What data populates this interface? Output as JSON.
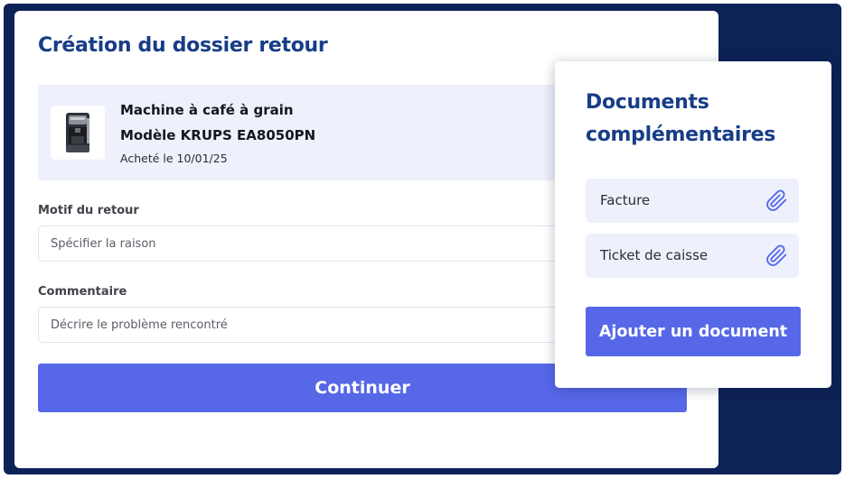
{
  "main": {
    "title": "Création du dossier retour",
    "product": {
      "name": "Machine à café à grain",
      "model": "Modèle KRUPS EA8050PN",
      "purchase_date": "Acheté le 10/01/25",
      "image_icon": "coffee-machine"
    },
    "fields": {
      "reason": {
        "label": "Motif du retour",
        "placeholder": "Spécifier la raison",
        "value": ""
      },
      "comment": {
        "label": "Commentaire",
        "placeholder": "Décrire le problème rencontré",
        "value": ""
      }
    },
    "continue_label": "Continuer"
  },
  "documents": {
    "title_line1": "Documents",
    "title_line2": "complémentaires",
    "items": [
      {
        "label": "Facture",
        "icon": "paperclip-icon"
      },
      {
        "label": "Ticket de caisse",
        "icon": "paperclip-icon"
      }
    ],
    "add_label": "Ajouter un document"
  },
  "colors": {
    "frame_background": "#0d2257",
    "title_blue": "#183d87",
    "accent_button": "#5668e8",
    "light_panel": "#eef0fb",
    "paperclip": "#5668e8"
  }
}
